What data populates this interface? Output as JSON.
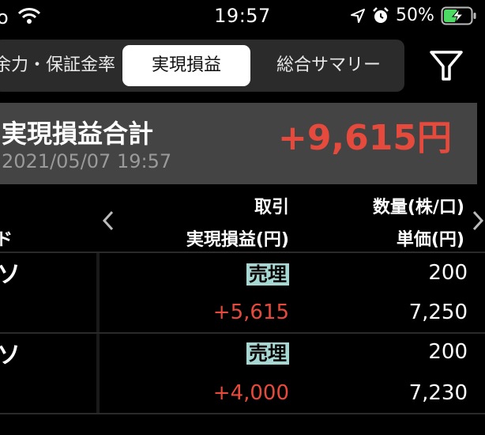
{
  "status_bar": {
    "carrier": "o",
    "time": "19:57",
    "battery_percent": "50%",
    "battery_level": 0.5
  },
  "tabs": [
    {
      "label": "余力・保証金率",
      "selected": false
    },
    {
      "label": "実現損益",
      "selected": true
    },
    {
      "label": "総合サマリー",
      "selected": false
    }
  ],
  "summary": {
    "label": "実現損益合計",
    "value": "+9,615円",
    "date": "2021/05/07 19:57"
  },
  "table_header": {
    "col_code": "ド",
    "col_trade": "取引",
    "col_pnl": "実現損益(円)",
    "col_qty": "数量(株/口)",
    "col_price": "単価(円)"
  },
  "rows": [
    {
      "name": "ソ",
      "trade": "売埋",
      "pnl": "+5,615",
      "qty": "200",
      "price": "7,250"
    },
    {
      "name": "ソ",
      "trade": "売埋",
      "pnl": "+4,000",
      "qty": "200",
      "price": "7,230"
    }
  ],
  "colors": {
    "positive": "#e64a3c",
    "badge_bg": "#a7d7d3",
    "battery_fill": "#4cd964"
  }
}
